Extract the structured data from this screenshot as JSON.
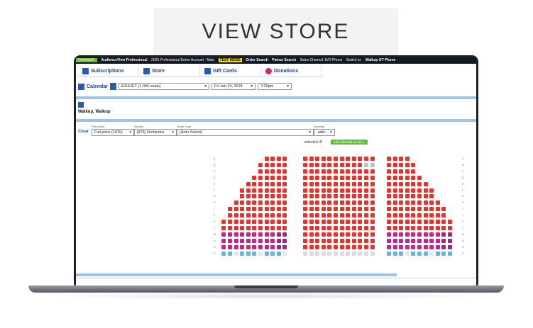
{
  "headline": "VIEW STORE",
  "topbar": {
    "quicksell": "QuickSell+",
    "app": "AudienceView Professional",
    "account": "2020 Professional Demo Account - Main",
    "test_mode": "TEST MODE",
    "order_search": "Order Search",
    "patron_search": "Patron Search",
    "sales_channel": "Sales Channel: B/O Phone",
    "switch_to": "Switch to:",
    "switch_target": "Walkup OT Phone"
  },
  "tabs": [
    {
      "label": "Subscriptions",
      "icon": "subscriptions-icon"
    },
    {
      "label": "Store",
      "icon": "store-icon"
    },
    {
      "label": "Gift Cards",
      "icon": "gift-card-icon"
    },
    {
      "label": "Donations",
      "icon": "heart-icon"
    }
  ],
  "calendar": {
    "label": "Calendar",
    "event": "&JULIET (1,066 seats)",
    "date": "Fri Jan 19, 2024",
    "time": "7:00pm"
  },
  "patron_name": "Walkup, Walkup",
  "ticket": {
    "clear": "Clear",
    "promotion_label": "Promotion",
    "promotion": "Full price (1076)",
    "section_label": "Section",
    "section": "[476] Orchestra",
    "ticket_type_label": "Ticket Type",
    "ticket_type": "(Auto Select)",
    "quantity_label": "Quantity",
    "quantity": "-add-"
  },
  "selected_label": "selected:",
  "selected_count": "0",
  "add_button": "Add selected to cart »",
  "colors": {
    "available": "#e8322b",
    "premium": "#c0268c",
    "accessible": "#63b7df",
    "held": "#b9c0c8",
    "purple": "#9a2a7f"
  },
  "seatmap": {
    "row_letters": [
      "A",
      "B",
      "C",
      "D",
      "E",
      "F",
      "G",
      "H",
      "I",
      "J",
      "K",
      "L",
      "M",
      "N",
      "O",
      "P"
    ]
  }
}
